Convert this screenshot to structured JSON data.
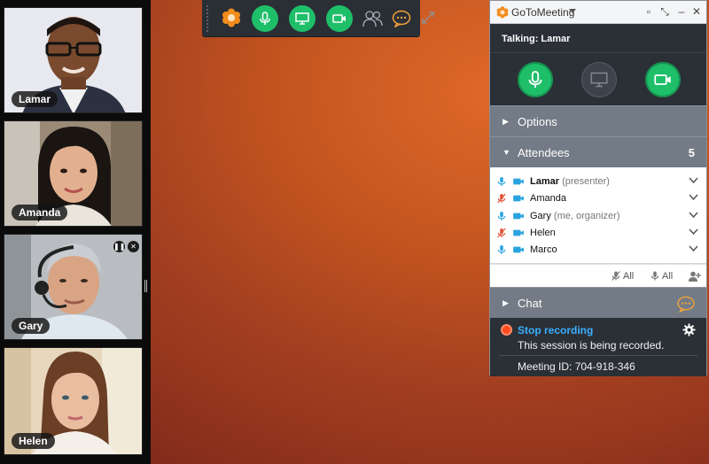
{
  "participants": [
    {
      "name": "Lamar"
    },
    {
      "name": "Amanda"
    },
    {
      "name": "Gary"
    },
    {
      "name": "Helen"
    }
  ],
  "toolbar": {
    "buttons": [
      "logo-icon",
      "microphone-icon",
      "screen-share-icon",
      "camera-icon",
      "attendees-icon",
      "chat-icon",
      "expand-icon"
    ]
  },
  "panel": {
    "app_name": "GoToMeeting",
    "talking_label": "Talking:",
    "talking_name": "Lamar",
    "options_label": "Options",
    "attendees_label": "Attendees",
    "attendees_count": "5",
    "attendees": [
      {
        "name": "Lamar",
        "role": "(presenter)",
        "muted": false,
        "presenter": true
      },
      {
        "name": "Amanda",
        "role": "",
        "muted": true,
        "presenter": false
      },
      {
        "name": "Gary",
        "role": "(me, organizer)",
        "muted": false,
        "presenter": false
      },
      {
        "name": "Helen",
        "role": "",
        "muted": true,
        "presenter": false
      },
      {
        "name": "Marco",
        "role": "",
        "muted": false,
        "presenter": false
      }
    ],
    "mute_all_label": "All",
    "unmute_all_label": "All",
    "chat_label": "Chat",
    "stop_recording_label": "Stop recording",
    "recording_text": "This session is being recorded.",
    "meeting_id_text": "Meeting ID: 704-918-346"
  },
  "colors": {
    "accent_green": "#1fbf6a",
    "recording_red": "#ff4b1f",
    "link_blue": "#3ab0ff",
    "mic_blue": "#2aa4e0",
    "mic_muted": "#e2553a"
  }
}
